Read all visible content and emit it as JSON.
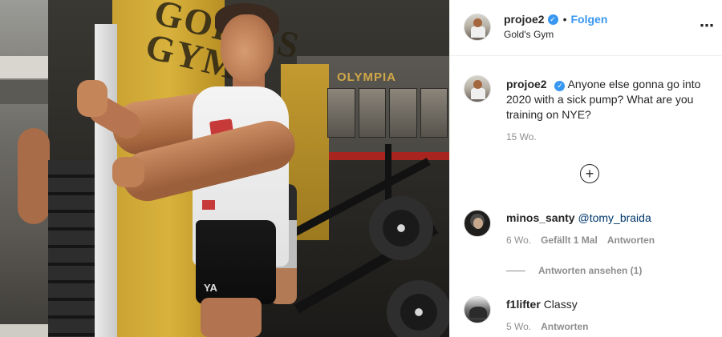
{
  "post": {
    "username": "projoe2",
    "verified_mark": "✓",
    "separator": "•",
    "follow_label": "Folgen",
    "location": "Gold's Gym",
    "more_icon": "⋯"
  },
  "photo": {
    "wall_text": "GOLD'S GYM",
    "olympia_text": "OLYMPIA",
    "shorts_logo": "YA"
  },
  "caption": {
    "username": "projoe2",
    "verified_mark": "✓",
    "text": "Anyone else gonna go into 2020 with a sick pump? What are you training on NYE?",
    "time": "15 Wo."
  },
  "load_more": {
    "icon": "+"
  },
  "comments": [
    {
      "username": "minos_santy",
      "mention": "@tomy_braida",
      "text": "",
      "time": "6 Wo.",
      "likes": "Gefällt 1 Mal",
      "reply_label": "Antworten",
      "view_replies": "Antworten ansehen (1)"
    },
    {
      "username": "f1lifter",
      "mention": "",
      "text": "Classy",
      "time": "5 Wo.",
      "reply_label": "Antworten"
    }
  ],
  "colors": {
    "accent_blue": "#3897f0",
    "mention_blue": "#00376b",
    "meta_gray": "#8e8e8e",
    "text": "#262626"
  }
}
